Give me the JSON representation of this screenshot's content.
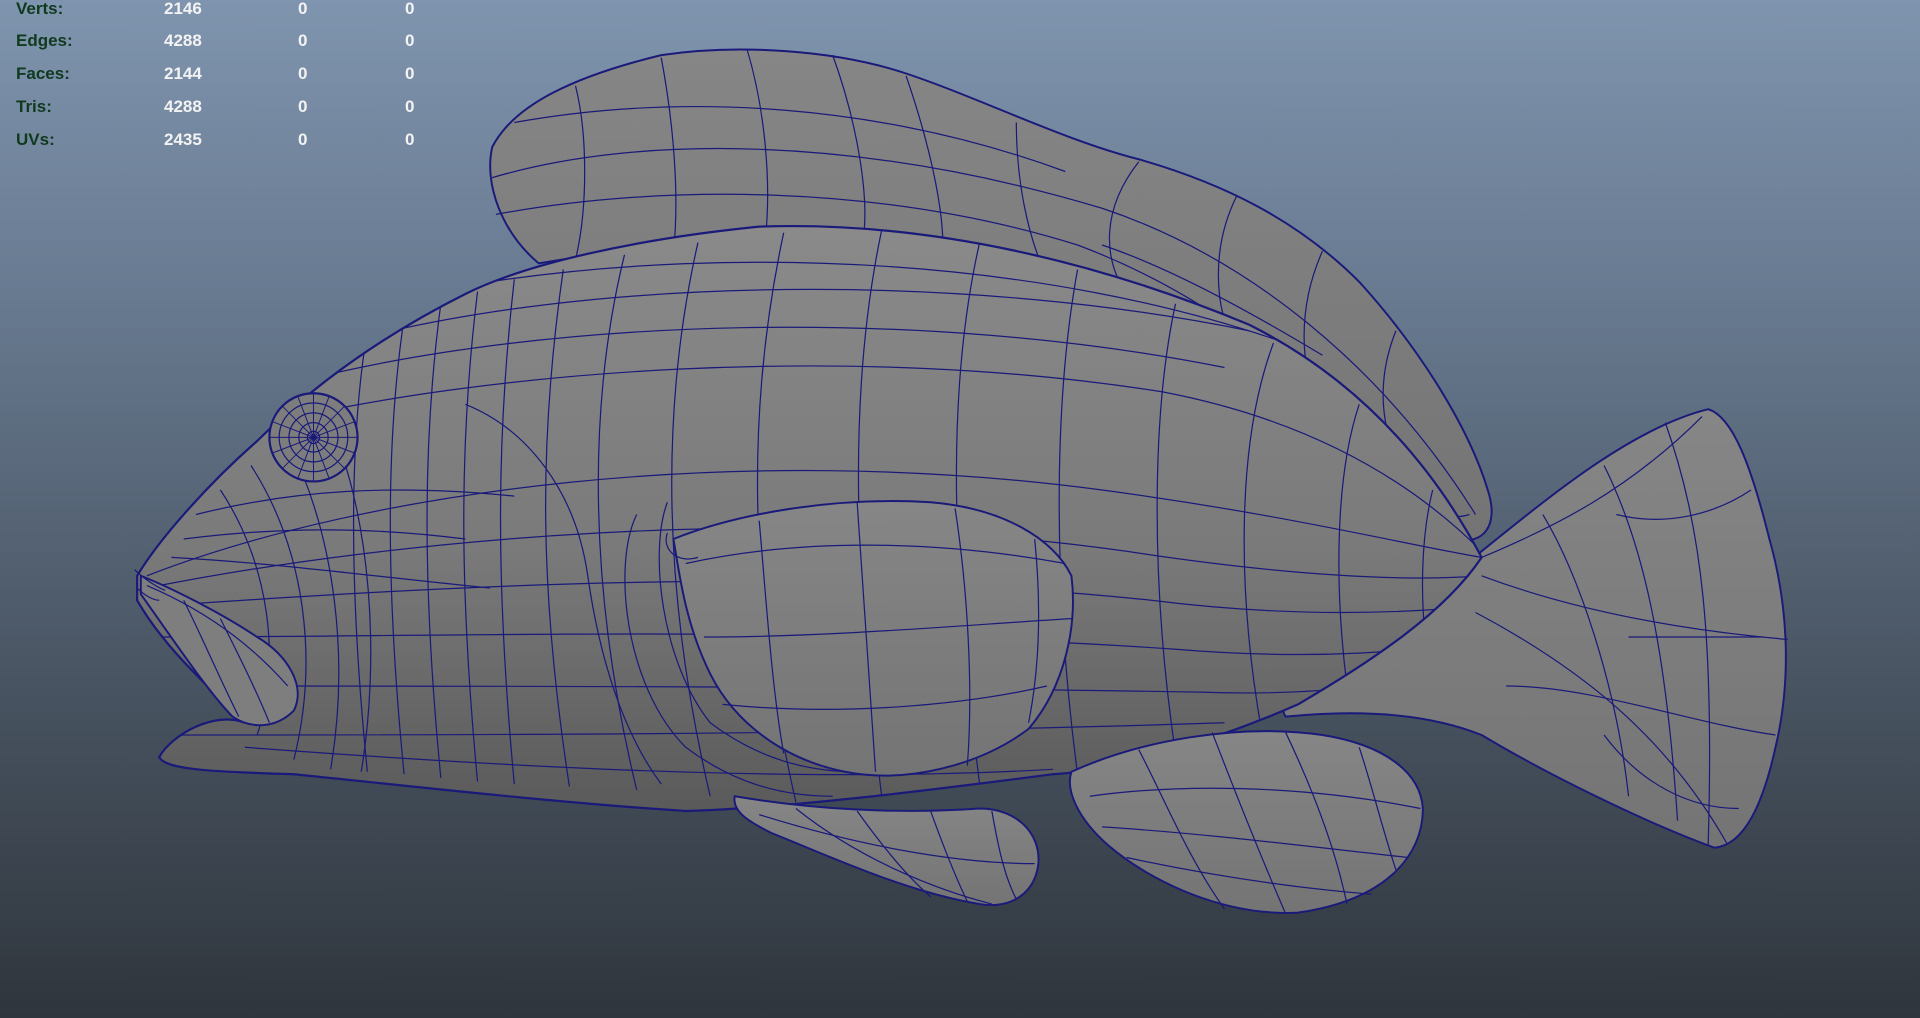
{
  "viewport": {
    "background_top": "#7f94ae",
    "background_bottom": "#2f353c",
    "wire_color": "#1a1a7a",
    "shade_color": "#7b7b7b"
  },
  "hud": {
    "label_color": "#0f3a1e",
    "value_color": "#f3f3f3",
    "rows": [
      {
        "label": "Verts:",
        "v1": "2146",
        "v2": "0",
        "v3": "0"
      },
      {
        "label": "Edges:",
        "v1": "4288",
        "v2": "0",
        "v3": "0"
      },
      {
        "label": "Faces:",
        "v1": "2144",
        "v2": "0",
        "v3": "0"
      },
      {
        "label": "Tris:",
        "v1": "4288",
        "v2": "0",
        "v3": "0"
      },
      {
        "label": "UVs:",
        "v1": "2435",
        "v2": "0",
        "v3": "0"
      }
    ]
  }
}
